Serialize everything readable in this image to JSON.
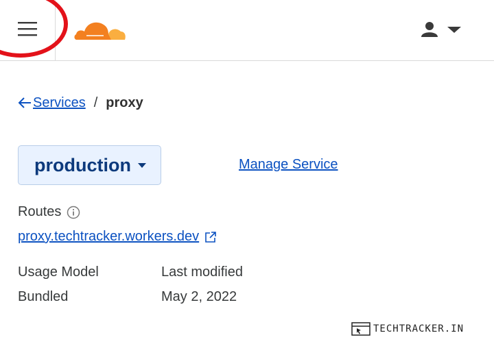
{
  "header": {
    "menu_icon": "hamburger-menu-icon",
    "logo_icon": "cloudflare-cloud-logo",
    "user_icon": "user-avatar-icon",
    "user_caret_icon": "caret-down-icon",
    "brand_color": "#f38020",
    "annotation_color": "#e3121a"
  },
  "breadcrumb": {
    "back_icon": "arrow-left-icon",
    "parent_label": "Services",
    "separator": "/",
    "current": "proxy"
  },
  "environment": {
    "selected": "production",
    "caret_icon": "caret-down-icon"
  },
  "manage_service_label": "Manage Service",
  "routes": {
    "label": "Routes",
    "info_icon": "info-icon",
    "url": "proxy.techtracker.workers.dev",
    "external_icon": "external-link-icon"
  },
  "details": {
    "usage_model_label": "Usage Model",
    "usage_model_value": "Bundled",
    "last_modified_label": "Last modified",
    "last_modified_value": "May 2, 2022"
  },
  "watermark": "TECHTRACKER.IN",
  "colors": {
    "link": "#0b51c1",
    "select_bg": "#e9f2ff",
    "select_text": "#0d3a7c"
  }
}
